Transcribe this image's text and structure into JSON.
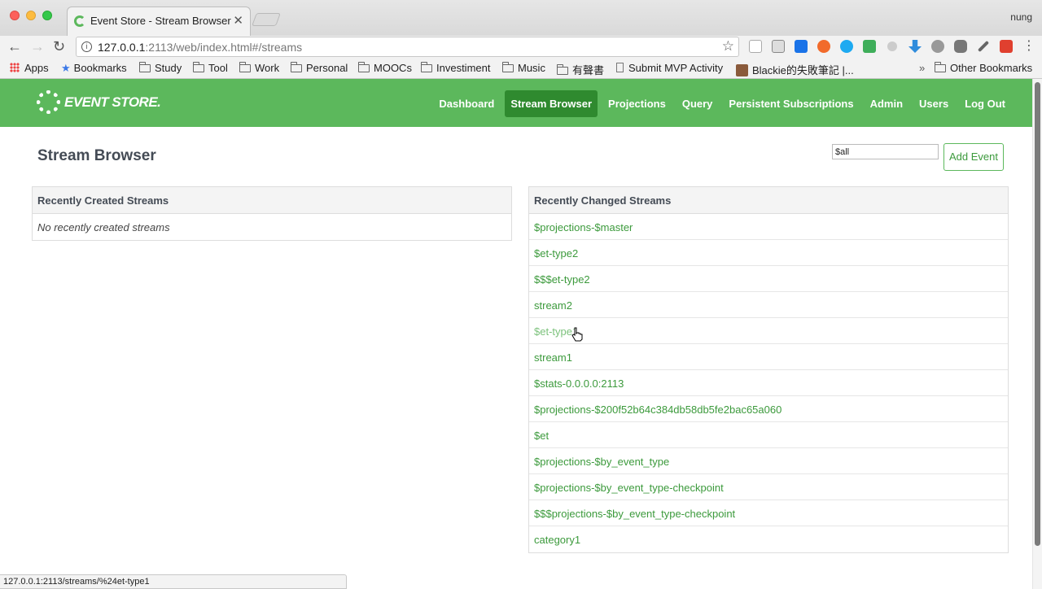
{
  "browser": {
    "tab_title": "Event Store - Stream Browser",
    "tab_close": "✕",
    "profile_name": "nung",
    "url_host": "127.0.0.1",
    "url_rest": ":2113/web/index.html#/streams",
    "info_glyph": "i",
    "bookmarks": {
      "apps": "Apps",
      "bookmarks": "Bookmarks",
      "study": "Study",
      "tool": "Tool",
      "work": "Work",
      "personal": "Personal",
      "moocs": "MOOCs",
      "investiment": "Investiment",
      "music": "Music",
      "audiobooks": "有聲書",
      "submit_mvp": "Submit MVP Activity",
      "blackie": "Blackie的失敗筆記 |...",
      "overflow": "»",
      "other": "Other Bookmarks"
    },
    "status_url": "127.0.0.1:2113/streams/%24et-type1"
  },
  "app": {
    "logo_text": "EVENT STORE.",
    "nav": {
      "dashboard": "Dashboard",
      "stream_browser": "Stream Browser",
      "projections": "Projections",
      "query": "Query",
      "persistent": "Persistent Subscriptions",
      "admin": "Admin",
      "users": "Users",
      "logout": "Log Out"
    },
    "page_title": "Stream Browser",
    "stream_input_value": "$all",
    "add_event_label": "Add Event",
    "recently_created": {
      "title": "Recently Created Streams",
      "empty": "No recently created streams"
    },
    "recently_changed": {
      "title": "Recently Changed Streams",
      "streams": [
        "$projections-$master",
        "$et-type2",
        "$$$et-type2",
        "stream2",
        "$et-type1",
        "stream1",
        "$stats-0.0.0.0:2113",
        "$projections-$200f52b64c384db58db5fe2bac65a060",
        "$et",
        "$projections-$by_event_type",
        "$projections-$by_event_type-checkpoint",
        "$$$projections-$by_event_type-checkpoint",
        "category1"
      ]
    }
  },
  "colors": {
    "brand_green": "#5cb85c",
    "active_nav": "#2f8a2f",
    "link": "#3c9a3c"
  }
}
